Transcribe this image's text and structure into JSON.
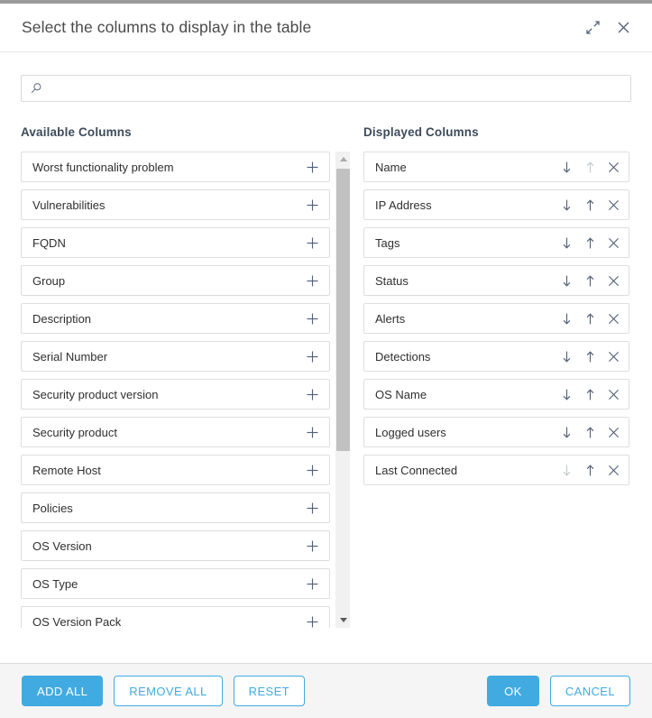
{
  "dialog": {
    "title": "Select the columns to display in the table",
    "expand_icon": "expand-icon",
    "close_icon": "close-icon"
  },
  "search": {
    "value": "",
    "placeholder": "",
    "icon": "search-icon"
  },
  "available": {
    "heading": "Available Columns",
    "add_icon": "plus-icon",
    "items": [
      {
        "label": "Worst functionality problem"
      },
      {
        "label": "Vulnerabilities"
      },
      {
        "label": "FQDN"
      },
      {
        "label": "Group"
      },
      {
        "label": "Description"
      },
      {
        "label": "Serial Number"
      },
      {
        "label": "Security product version"
      },
      {
        "label": "Security product"
      },
      {
        "label": "Remote Host"
      },
      {
        "label": "Policies"
      },
      {
        "label": "OS Version"
      },
      {
        "label": "OS Type"
      },
      {
        "label": "OS Version Pack"
      }
    ],
    "scrollbar": {
      "up_icon": "scroll-up-arrow-icon",
      "down_icon": "scroll-down-arrow-icon"
    }
  },
  "displayed": {
    "heading": "Displayed Columns",
    "move_down_icon": "arrow-down-icon",
    "move_up_icon": "arrow-up-icon",
    "remove_icon": "close-icon",
    "items": [
      {
        "label": "Name",
        "can_move_down": true,
        "can_move_up": false
      },
      {
        "label": "IP Address",
        "can_move_down": true,
        "can_move_up": true
      },
      {
        "label": "Tags",
        "can_move_down": true,
        "can_move_up": true
      },
      {
        "label": "Status",
        "can_move_down": true,
        "can_move_up": true
      },
      {
        "label": "Alerts",
        "can_move_down": true,
        "can_move_up": true
      },
      {
        "label": "Detections",
        "can_move_down": true,
        "can_move_up": true
      },
      {
        "label": "OS Name",
        "can_move_down": true,
        "can_move_up": true
      },
      {
        "label": "Logged users",
        "can_move_down": true,
        "can_move_up": true
      },
      {
        "label": "Last Connected",
        "can_move_down": false,
        "can_move_up": true
      }
    ]
  },
  "footer": {
    "add_all_label": "ADD ALL",
    "remove_all_label": "REMOVE ALL",
    "reset_label": "RESET",
    "ok_label": "OK",
    "cancel_label": "CANCEL"
  },
  "colors": {
    "accent": "#41abe1",
    "title_text": "#4a4a4a",
    "heading_text": "#3e4b5b",
    "row_border": "#dedede",
    "footer_bg": "#f5f5f5",
    "scroll_thumb": "#c1c1c1",
    "scroll_track": "#f1f1f1",
    "top_strip": "#9b9b9b",
    "icon": "#53617a",
    "icon_disabled": "#c3c8d0"
  }
}
